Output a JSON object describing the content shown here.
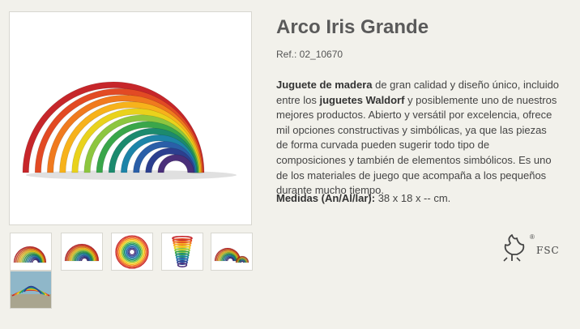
{
  "product": {
    "title": "Arco Iris Grande",
    "ref": "Ref.: 02_10670",
    "description": {
      "p1_bold": "Juguete de madera",
      "p2": " de gran calidad y diseño único, incluido entre los ",
      "p3_bold": "juguetes Waldorf",
      "p4": " y posiblemente uno de nuestros mejores productos. Abierto y versátil por excelencia, ofrece mil opciones constructivas y simbólicas, ya que las piezas de forma curvada pueden sugerir todo tipo de composiciones y también de elementos simbólicos. Es uno de los materiales de juego que acompaña a los pequeños durante mucho tiempo."
    },
    "measures_label": "Medidas (An/Al/lar):",
    "measures_value": " 38 x 18 x -- cm."
  },
  "certification": {
    "label": "FSC",
    "registered_mark": "®",
    "icon": "fsc-tree-icon"
  },
  "gallery": {
    "thumbnails": [
      "rainbow-front",
      "rainbow-angle",
      "rainbow-spread",
      "rainbow-stacked",
      "rainbow-split",
      "rainbow-outdoor"
    ]
  },
  "colors": {
    "arcs": [
      "#c6262a",
      "#e24a24",
      "#f07a1e",
      "#f7b21b",
      "#e9d21c",
      "#8dc63f",
      "#3aa64a",
      "#1c8a6e",
      "#1d84a8",
      "#2a5fa8",
      "#2c3f8f",
      "#4a2f7a"
    ],
    "background": "#f2f1eb"
  }
}
